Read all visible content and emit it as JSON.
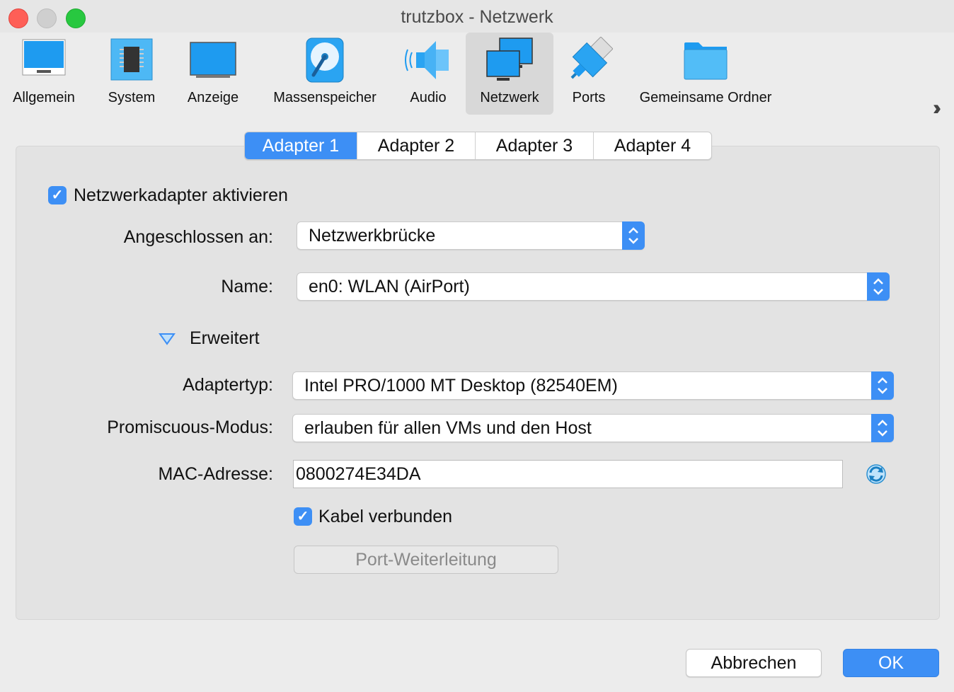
{
  "window": {
    "title": "trutzbox - Netzwerk"
  },
  "toolbar": {
    "items": [
      {
        "label": "Allgemein",
        "icon": "monitor-icon"
      },
      {
        "label": "System",
        "icon": "chip-icon"
      },
      {
        "label": "Anzeige",
        "icon": "display-icon"
      },
      {
        "label": "Massenspeicher",
        "icon": "disk-icon"
      },
      {
        "label": "Audio",
        "icon": "speaker-icon"
      },
      {
        "label": "Netzwerk",
        "icon": "network-icon",
        "selected": true
      },
      {
        "label": "Ports",
        "icon": "ports-icon"
      },
      {
        "label": "Gemeinsame Ordner",
        "icon": "folder-icon"
      }
    ],
    "more_icon": "chevron-double-right-icon"
  },
  "tabs": [
    {
      "label": "Adapter 1",
      "active": true
    },
    {
      "label": "Adapter 2"
    },
    {
      "label": "Adapter 3"
    },
    {
      "label": "Adapter 4"
    }
  ],
  "form": {
    "enable_label": "Netzwerkadapter aktivieren",
    "enable_checked": true,
    "attached_label": "Angeschlossen an:",
    "attached_value": "Netzwerkbrücke",
    "name_label": "Name:",
    "name_value": "en0: WLAN (AirPort)",
    "advanced_label": "Erweitert",
    "adapter_type_label": "Adaptertyp:",
    "adapter_type_value": "Intel PRO/1000 MT Desktop (82540EM)",
    "promisc_label": "Promiscuous-Modus:",
    "promisc_value": "erlauben für allen VMs und den Host",
    "mac_label": "MAC-Adresse:",
    "mac_value": "0800274E34DA",
    "cable_label": "Kabel verbunden",
    "cable_checked": true,
    "port_forward_label": "Port-Weiterleitung"
  },
  "footer": {
    "cancel_label": "Abbrechen",
    "ok_label": "OK"
  },
  "colors": {
    "accent": "#3d8ff5",
    "icon_blue": "#1e9bf0"
  }
}
